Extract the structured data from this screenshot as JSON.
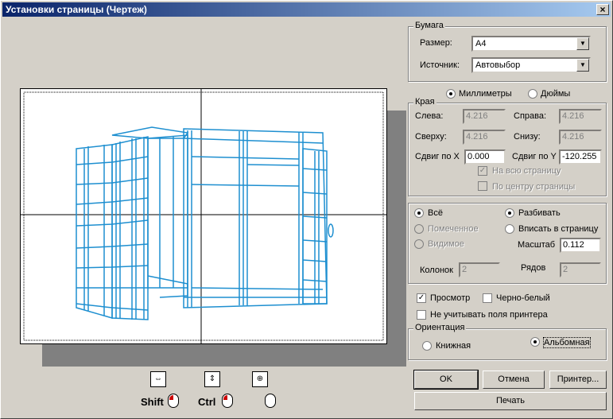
{
  "window": {
    "title": "Установки страницы (Чертеж)",
    "close": "×"
  },
  "paper": {
    "group_title": "Бумага",
    "size_label": "Размер:",
    "size_value": "A4",
    "source_label": "Источник:",
    "source_value": "Автовыбор"
  },
  "units": {
    "mm_label": "Миллиметры",
    "inch_label": "Дюймы",
    "selected": "mm"
  },
  "margins": {
    "group_title": "Края",
    "left_label": "Слева:",
    "left_value": "4.216",
    "right_label": "Справа:",
    "right_value": "4.216",
    "top_label": "Сверху:",
    "top_value": "4.216",
    "bottom_label": "Снизу:",
    "bottom_value": "4.216",
    "shift_x_label": "Сдвиг по X",
    "shift_x_value": "0.000",
    "shift_y_label": "Сдвиг по Y",
    "shift_y_value": "-120.255",
    "full_page_label": "На всю страницу",
    "center_page_label": "По центру страницы"
  },
  "print_range": {
    "all_label": "Всё",
    "marked_label": "Помеченное",
    "visible_label": "Видимое",
    "split_label": "Разбивать",
    "fit_label": "Вписать в страницу",
    "scale_label": "Масштаб",
    "scale_value": "0.112",
    "columns_label": "Колонок",
    "columns_value": "2",
    "rows_label": "Рядов",
    "rows_value": "2"
  },
  "options": {
    "preview_label": "Просмотр",
    "bw_label": "Черно-белый",
    "ignore_margins_label": "Не учитывать поля принтера"
  },
  "orientation": {
    "group_title": "Ориентация",
    "portrait_label": "Книжная",
    "landscape_label": "Альбомная"
  },
  "buttons": {
    "ok": "OK",
    "cancel": "Отмена",
    "printer": "Принтер...",
    "print": "Печать"
  },
  "modifiers": {
    "shift": "Shift",
    "ctrl": "Ctrl"
  }
}
